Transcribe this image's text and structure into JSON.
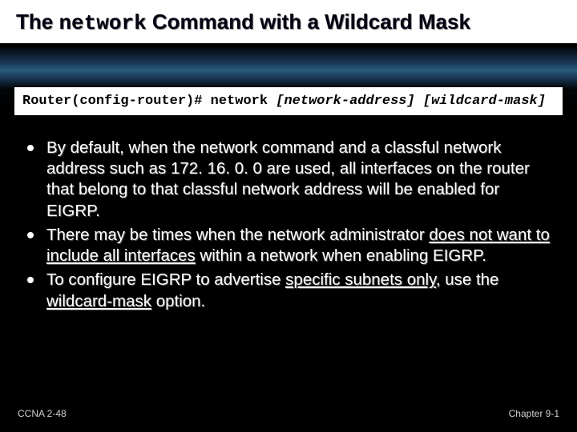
{
  "title": {
    "pre": "The ",
    "mono": "network",
    "post": " Command with a Wildcard Mask"
  },
  "command": {
    "prompt": "Router(config-router)# network ",
    "args": "[network-address] [wildcard-mask]"
  },
  "bullets": [
    {
      "parts": [
        {
          "text": "By default, when the network command and a classful network address such as 172. 16. 0. 0 are used, all interfaces on the router that belong to that classful network address will be enabled for EIGRP."
        }
      ]
    },
    {
      "parts": [
        {
          "text": "There may be times when the network administrator "
        },
        {
          "text": "does not want to include all interfaces",
          "style": "underline"
        },
        {
          "text": " within a network when enabling EIGRP."
        }
      ]
    },
    {
      "parts": [
        {
          "text": "To configure EIGRP to advertise "
        },
        {
          "text": "specific subnets only",
          "style": "underline"
        },
        {
          "text": ", use the "
        },
        {
          "text": "wildcard-mask",
          "style": "underline"
        },
        {
          "text": " option."
        }
      ]
    }
  ],
  "footer": {
    "left": "CCNA 2-48",
    "right": "Chapter  9-1"
  }
}
